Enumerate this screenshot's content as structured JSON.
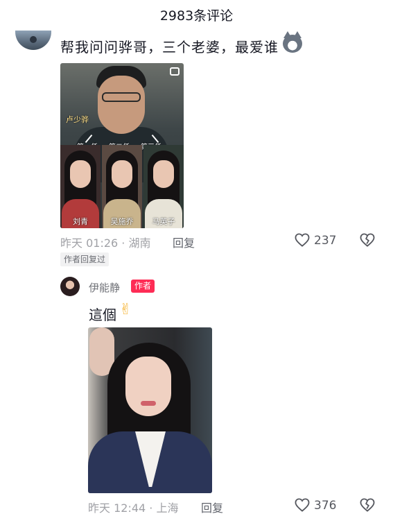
{
  "header": {
    "title": "2983条评论"
  },
  "comment": {
    "text": "帮我问问骅哥，三个老婆，最爱谁",
    "emoji": "cat-face-emoji",
    "image": {
      "top_label": "卢少骅",
      "arrows": [
        "第一任",
        "第二任",
        "第三任"
      ],
      "names": [
        "刘青",
        "吴施乔",
        "马英子"
      ]
    },
    "meta": "昨天 01:26 · 湖南",
    "reply_label": "回复",
    "likes": "237",
    "author_replied": "作者回复过"
  },
  "reply": {
    "username": "伊能静",
    "badge": "作者",
    "text": "這個",
    "emoji": "✌",
    "meta": "昨天 12:44 · 上海",
    "reply_label": "回复",
    "likes": "376"
  },
  "colors": {
    "accent": "#fe2c55",
    "text": "#161823",
    "meta": "#a0a1a6"
  }
}
